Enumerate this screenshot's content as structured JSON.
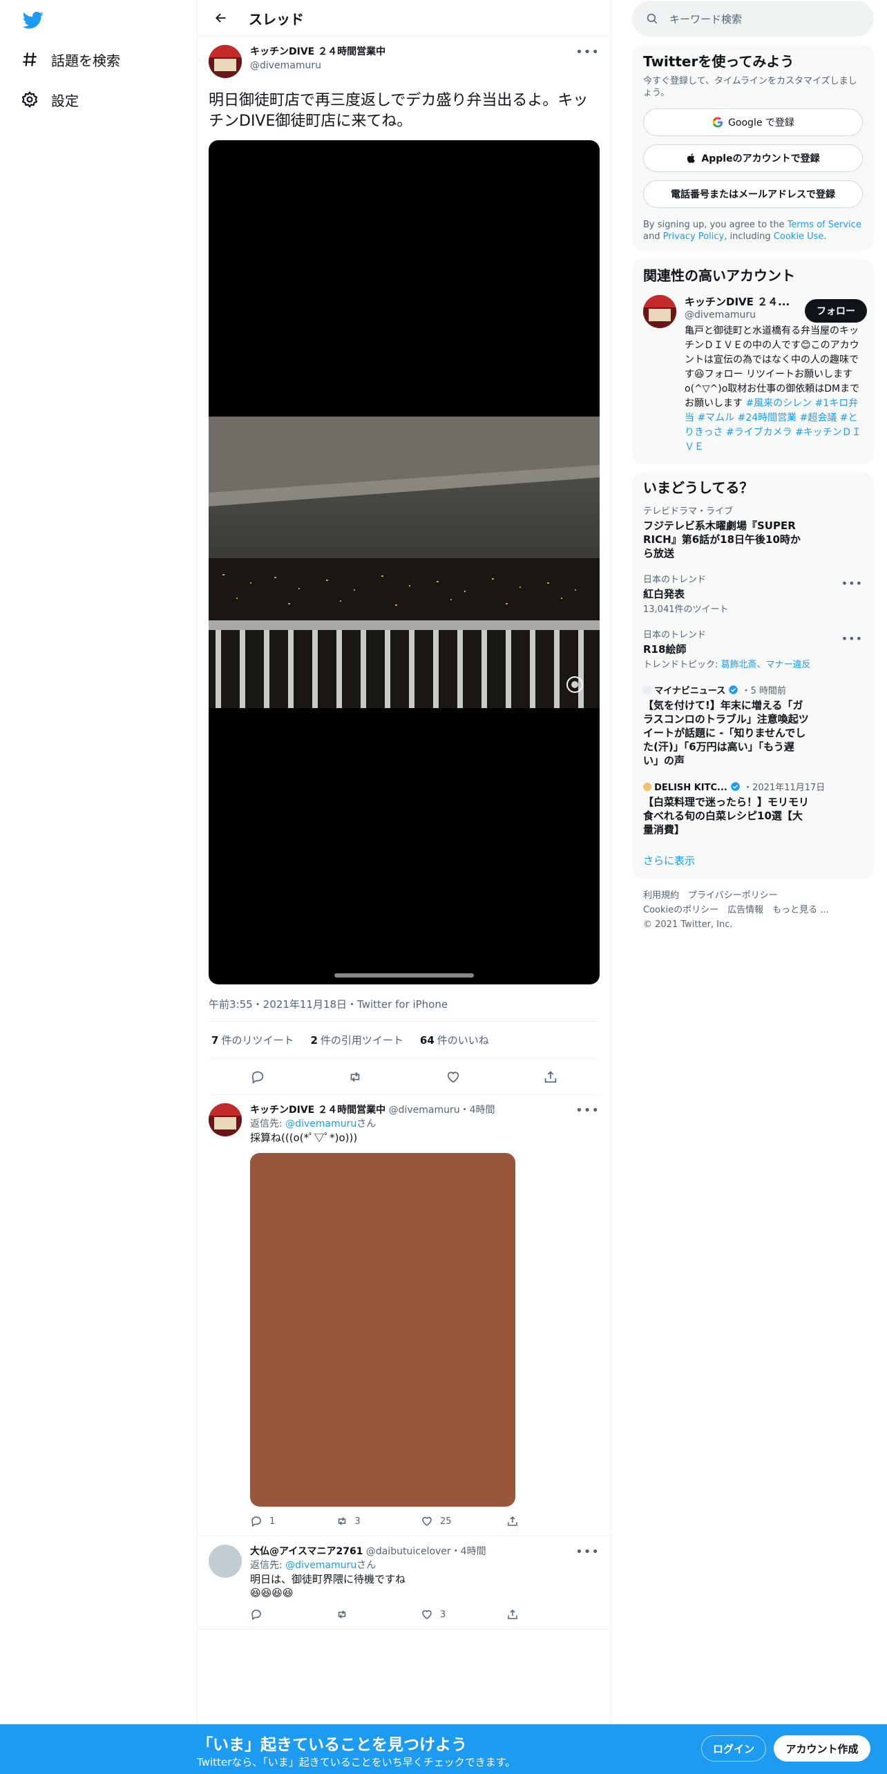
{
  "nav": {
    "explore_label": "話題を検索",
    "settings_label": "設定"
  },
  "header": {
    "title": "スレッド"
  },
  "main_tweet": {
    "display_name": "キッチンDIVE ２４時間営業中",
    "handle": "@divemamuru",
    "text": "明日御徒町店で再三度返しでデカ盛り弁当出るよ。キッチンDIVE御徒町店に来てね。",
    "meta": "午前3:55・2021年11月18日・Twitter for iPhone",
    "retweets_count": "7",
    "retweets_label": "件のリツイート",
    "quotes_count": "2",
    "quotes_label": "件の引用ツイート",
    "likes_count": "64",
    "likes_label": "件のいいね"
  },
  "replies": [
    {
      "display_name": "キッチンDIVE ２４時間営業中",
      "handle": "@divemamuru",
      "time": "・4時間",
      "replying_to_prefix": "返信先: ",
      "replying_to_handle": "@divemamuru",
      "replying_to_suffix": "さん",
      "text": "採算ね(((o(*ﾟ▽ﾟ*)o)))",
      "reply_count": "1",
      "retweet_count": "3",
      "like_count": "25"
    },
    {
      "display_name": "大仏@アイスマニア2761",
      "handle": "@daibutuicelover",
      "time": "・4時間",
      "replying_to_prefix": "返信先: ",
      "replying_to_handle": "@divemamuru",
      "replying_to_suffix": "さん",
      "text": "明日は、御徒町界隈に待機ですね",
      "emoji": "😆😆😆😆",
      "reply_count": "",
      "retweet_count": "",
      "like_count": "3"
    }
  ],
  "search": {
    "placeholder": "キーワード検索"
  },
  "signup": {
    "title": "Twitterを使ってみよう",
    "subtitle": "今すぐ登録して、タイムラインをカスタマイズしましょう。",
    "google_button": "Google で登録",
    "apple_button": "Appleのアカウントで登録",
    "phone_button": "電話番号またはメールアドレスで登録",
    "terms_prefix": "By signing up, you agree to the ",
    "terms_link": "Terms of Service",
    "terms_and": " and ",
    "privacy_link": "Privacy Policy",
    "terms_including": ", including ",
    "cookie_link": "Cookie Use",
    "terms_end": "."
  },
  "related": {
    "title": "関連性の高いアカウント",
    "display_name": "キッチンDIVE ２４...",
    "handle": "@divemamuru",
    "follow_button": "フォロー",
    "bio": "亀戸と御徒町と水道橋有る弁当屋のキッチンＤＩＶＥの中の人です😊このアカウントは宣伝の為ではなく中の人の趣味です😆フォロー リツイートお願いしますo(^▽^)o取材お仕事の御依頼はDMまでお願いします ",
    "hashtags": "#風来のシレン #1キロ弁当 #マムル #24時間営業 #超会議 #とりきっさ #ライブカメラ #キッチンＤＩＶＥ"
  },
  "trends": {
    "title": "いまどうしてる？",
    "items": [
      {
        "category": "テレビドラマ・ライブ",
        "title": "フジテレビ系木曜劇場『SUPER RICH』第6話が18日午後10時から放送",
        "count": ""
      },
      {
        "category": "日本のトレンド",
        "title": "紅白発表",
        "count": "13,041件のツイート"
      },
      {
        "category": "日本のトレンド",
        "title": "R18絵師",
        "count_prefix": "トレンドトピック: ",
        "count_links": "葛飾北斎、マナー違反"
      }
    ],
    "news": [
      {
        "source": "マイナビニュース",
        "time": "・5 時間前",
        "title": "【気を付けて!】年末に増える「ガラスコンロのトラブル」注意喚起ツイートが話題に -「知りませんでした(汗)」「6万円は高い」「もう遅い」の声"
      },
      {
        "source": "DELISH KITC...",
        "time": "・2021年11月17日",
        "title": "【白菜料理で迷ったら！】モリモリ食べれる旬の白菜レシピ10選【大量消費】"
      }
    ],
    "show_more": "さらに表示"
  },
  "footer": {
    "line1": "利用規約　プライバシーポリシー",
    "line2": "Cookieのポリシー　広告情報　もっと見る ...",
    "line3": "© 2021 Twitter, Inc."
  },
  "banner": {
    "title": "「いま」起きていることを見つけよう",
    "subtitle": "Twitterなら、「いま」起きていることをいち早くチェックできます。",
    "login_button": "ログイン",
    "signup_button": "アカウント作成"
  },
  "colors": {
    "accent": "#1d9bf0",
    "text": "#0f1419",
    "muted": "#536471",
    "media_placeholder": "#98573a"
  }
}
